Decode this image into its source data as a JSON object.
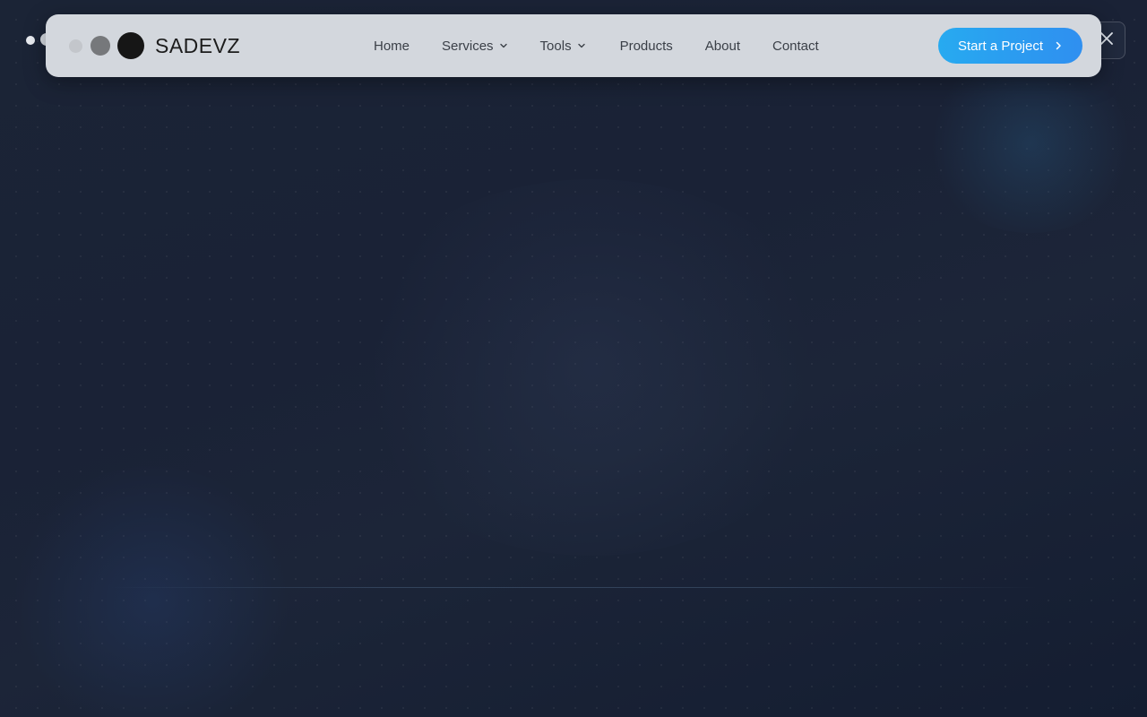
{
  "brand": {
    "name": "SADEVZ",
    "icons": [
      "logo-dot-small-icon",
      "logo-dot-medium-icon",
      "logo-dot-large-icon"
    ]
  },
  "nav": {
    "items": [
      {
        "label": "Home",
        "dropdown": false
      },
      {
        "label": "Services",
        "dropdown": true
      },
      {
        "label": "Tools",
        "dropdown": true
      },
      {
        "label": "Products",
        "dropdown": false
      },
      {
        "label": "About",
        "dropdown": false
      },
      {
        "label": "Contact",
        "dropdown": false
      }
    ]
  },
  "cta": {
    "label": "Start a Project",
    "icon": "chevron-right-icon"
  },
  "close": {
    "icon": "close-icon"
  },
  "colors": {
    "background": "#1a2236",
    "navbar": "#d3d7dd",
    "nav_text": "#3a3f47",
    "cta_start": "#27aaf0",
    "cta_end": "#2f8ff0"
  }
}
